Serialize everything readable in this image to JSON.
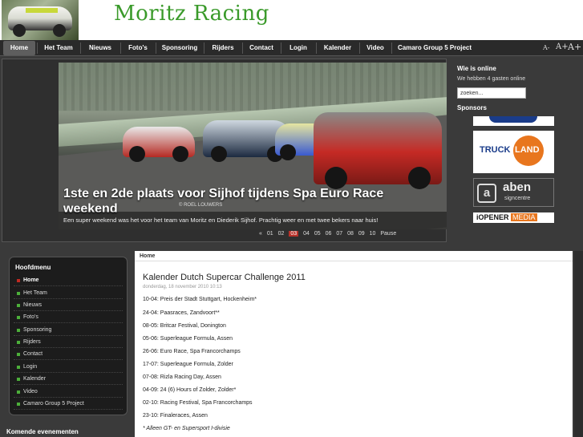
{
  "header": {
    "site_title": "Moritz Racing"
  },
  "nav": {
    "items": [
      "Home",
      "Het Team",
      "Nieuws",
      "Foto's",
      "Sponsoring",
      "Rijders",
      "Contact",
      "Login",
      "Kalender",
      "Video",
      "Camaro Group 5 Project"
    ],
    "font_sizes": [
      "A-",
      "A+",
      "A+"
    ]
  },
  "slideshow": {
    "title": "1ste en 2de plaats voor Sijhof tijdens Spa Euro Race weekend",
    "caption": "Een super weekend was het voor het team van Moritz en Diederik Sijhof. Prachtig weer en met twee bekers naar huis!",
    "photo_credit": "© ROEL LOUWERS",
    "pager": {
      "prev": "«",
      "pages": [
        "01",
        "02",
        "03",
        "04",
        "05",
        "06",
        "07",
        "08",
        "09",
        "10"
      ],
      "current_index": 2,
      "pause": "Pause"
    }
  },
  "who_online": {
    "title": "Wie is online",
    "text": "We hebben 4 gasten online"
  },
  "search": {
    "value": "zoeken..."
  },
  "sponsors": {
    "title": "Sponsors",
    "truckland": {
      "truck": "TRUCK",
      "land": "LAND"
    },
    "aben": {
      "mark": "a",
      "name": "aben",
      "sub": "signcentre"
    },
    "iopener": {
      "name": "iOPENER",
      "media": "MEDIA"
    }
  },
  "main_menu": {
    "title": "Hoofdmenu",
    "items": [
      "Home",
      "Het Team",
      "Nieuws",
      "Foto's",
      "Sponsoring",
      "Rijders",
      "Contact",
      "Login",
      "Kalender",
      "Video",
      "Camaro Group 5 Project"
    ],
    "active_index": 0
  },
  "events": {
    "title": "Komende evenementen"
  },
  "content": {
    "breadcrumb": "Home",
    "title": "Kalender Dutch Supercar Challenge 2011",
    "date": "donderdag, 18 november 2010 10:13",
    "rows": [
      "10-04: Preis der Stadt Stuttgart, Hockenheim*",
      "24-04: Paasraces, Zandvoort**",
      "08-05: Britcar Festival, Donington",
      "05-06: Superleague Formula, Assen",
      "26-06: Euro Race, Spa Francorchamps",
      "17-07: Superleague Formula, Zolder",
      "07-08: Rizla Racing Day, Assen",
      "04-09: 24 (6) Hours of Zolder, Zolder*",
      "02-10: Racing Festival, Spa Francorchamps",
      "23-10: Finaleraces, Assen"
    ],
    "note": "* Alleen GT- en Supersport I-divisie"
  }
}
